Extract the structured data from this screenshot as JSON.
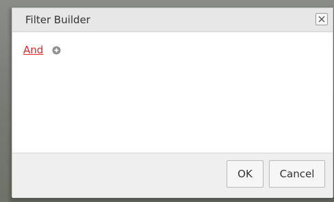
{
  "dialog": {
    "title": "Filter Builder",
    "close_icon": "close-icon"
  },
  "filter": {
    "group_operator": "And",
    "add_icon": "plus-circle-icon"
  },
  "footer": {
    "ok_label": "OK",
    "cancel_label": "Cancel"
  },
  "colors": {
    "group_operator": "#e8262a",
    "titlebar": "#e7e7e7",
    "footer": "#efefef"
  }
}
